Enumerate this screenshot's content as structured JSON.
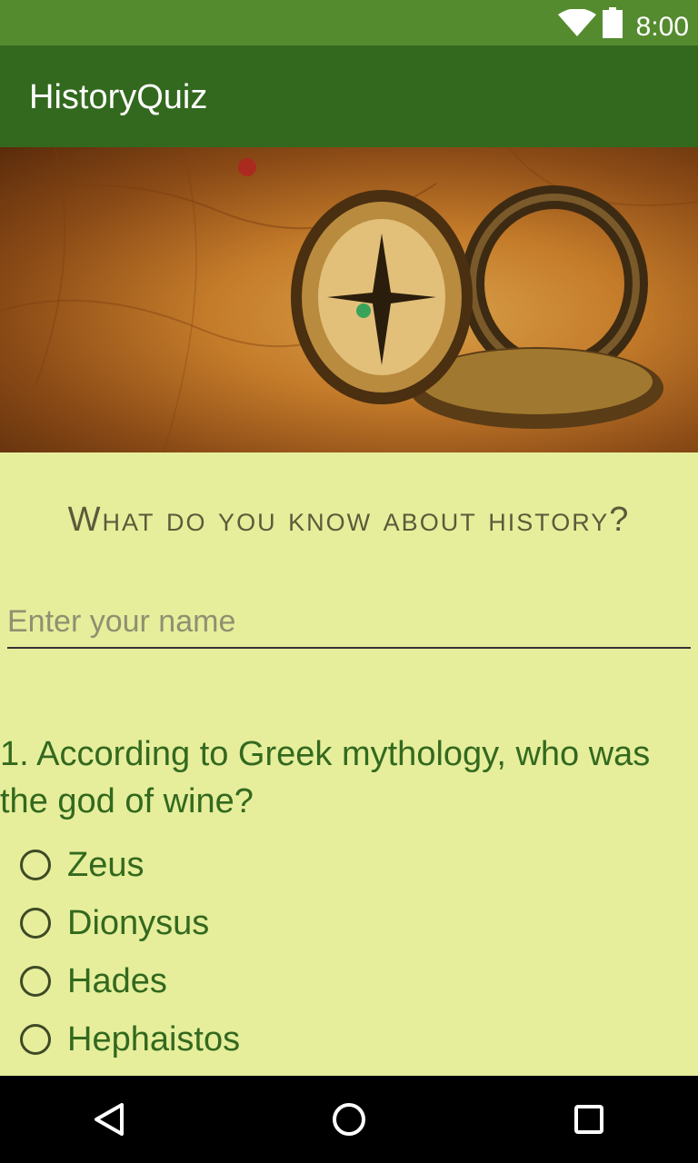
{
  "status_bar": {
    "time": "8:00"
  },
  "app_bar": {
    "title": "HistoryQuiz"
  },
  "main": {
    "heading": "What do you know about history?",
    "name_input": {
      "placeholder": "Enter your name",
      "value": ""
    },
    "question": {
      "text": "1. According to Greek mythology, who was the god of wine?",
      "options": [
        "Zeus",
        "Dionysus",
        "Hades",
        "Hephaistos"
      ]
    }
  },
  "colors": {
    "status_bar": "#558b2f",
    "app_bar": "#33691e",
    "background": "#e6ee9c",
    "accent_text": "#33691e"
  }
}
